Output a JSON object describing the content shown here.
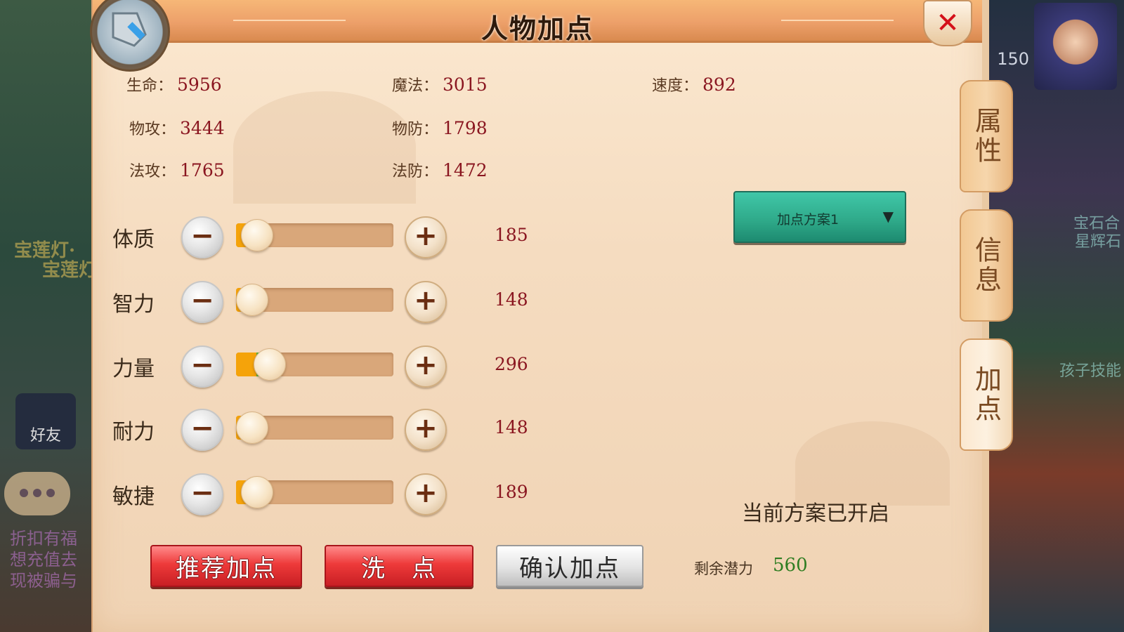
{
  "background": {
    "left_texts": [
      "宝莲灯·",
      "宝莲灯",
      "宝莲灯"
    ],
    "friend_label": "好友",
    "level": "150",
    "right_texts": [
      "星辉石",
      "孩子技能",
      "宝石合"
    ],
    "left_bottom_text": [
      "折扣有福",
      "想充值去",
      "现被骗与"
    ]
  },
  "dialog": {
    "title": "人物加点",
    "close_symbol": "✕"
  },
  "stats": {
    "hp_label": "生命：",
    "hp": "5956",
    "mp_label": "魔法：",
    "mp": "3015",
    "speed_label": "速度：",
    "speed": "892",
    "patk_label": "物攻：",
    "patk": "3444",
    "pdef_label": "物防：",
    "pdef": "1798",
    "matk_label": "法攻：",
    "matk": "1765",
    "mdef_label": "法防：",
    "mdef": "1472"
  },
  "attributes": [
    {
      "label": "体质",
      "value": "185",
      "base_fraction": 0.13,
      "added_fraction": 0.0
    },
    {
      "label": "智力",
      "value": "148",
      "base_fraction": 0.09,
      "added_fraction": 0.0
    },
    {
      "label": "力量",
      "value": "296",
      "base_fraction": 0.13,
      "added_fraction": 0.08
    },
    {
      "label": "耐力",
      "value": "148",
      "base_fraction": 0.09,
      "added_fraction": 0.0
    },
    {
      "label": "敏捷",
      "value": "189",
      "base_fraction": 0.13,
      "added_fraction": 0.0
    }
  ],
  "controls": {
    "minus_symbol": "−",
    "plus_symbol": "+"
  },
  "plan": {
    "selected": "加点方案1",
    "arrow": "▼",
    "status": "当前方案已开启"
  },
  "remaining": {
    "label": "剩余潜力",
    "value": "560"
  },
  "buttons": {
    "recommend": "推荐加点",
    "reset": "洗　点",
    "confirm": "确认加点"
  },
  "side_tabs": [
    {
      "label": "属性",
      "active": false
    },
    {
      "label": "信息",
      "active": false
    },
    {
      "label": "加点",
      "active": true
    }
  ],
  "colors": {
    "accent_red": "#d4101a",
    "value_red": "#8a1620",
    "remaining_green": "#2f7d22",
    "plan_teal": "#2ea888",
    "slider_fill": "#f5a30a",
    "slider_added": "#56b03a"
  }
}
